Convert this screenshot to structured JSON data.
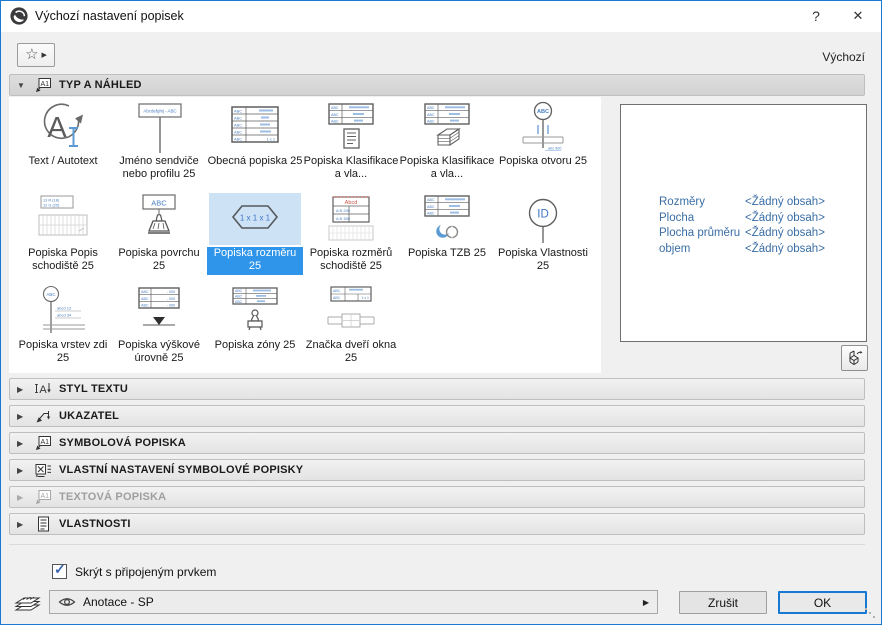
{
  "window": {
    "title": "Výchozí nastavení popisek",
    "help_glyph": "?",
    "close_glyph": "✕"
  },
  "toolbar": {
    "default_label": "Výchozí"
  },
  "sections": {
    "expanded_label": "TYP A NÁHLED",
    "collapsed": [
      {
        "label": "STYL TEXTU"
      },
      {
        "label": "UKAZATEL"
      },
      {
        "label": "SYMBOLOVÁ POPISKA"
      },
      {
        "label": "VLASTNÍ NASTAVENÍ SYMBOLOVÉ POPISKY"
      },
      {
        "label": "TEXTOVÁ POPISKA",
        "disabled": true
      },
      {
        "label": "VLASTNOSTI"
      }
    ]
  },
  "label_types": {
    "items": [
      {
        "label": "Text / Autotext"
      },
      {
        "label": "Jméno sendviče nebo profilu 25"
      },
      {
        "label": "Obecná popiska 25"
      },
      {
        "label": "Popiska Klasifikace a vla..."
      },
      {
        "label": "Popiska Klasifikace a vla..."
      },
      {
        "label": "Popiska otvoru 25"
      },
      {
        "label": "Popiska Popis schodiště 25"
      },
      {
        "label": "Popiska povrchu 25"
      },
      {
        "label": "Popiska rozměru 25",
        "selected": true
      },
      {
        "label": "Popiska rozměrů schodiště 25"
      },
      {
        "label": "Popiska TZB 25"
      },
      {
        "label": "Popiska Vlastnosti 25"
      },
      {
        "label": "Popiska vrstev zdi 25"
      },
      {
        "label": "Popiska výškové úrovně 25"
      },
      {
        "label": "Popiska zóny 25"
      },
      {
        "label": "Značka dveří okna 25"
      }
    ]
  },
  "icon_texts": {
    "autotext_a": "A",
    "sign": "Abcdefghij - ABC",
    "abc": "ABC",
    "hex": "1 x 1 x 1",
    "id": "ID",
    "stair_r": "13 R (18)",
    "stair_g": "12 G (25)",
    "dim_header": "Abcd",
    "dim_r1": "A B   200",
    "dim_r2": "A B   300",
    "layers_r1": "abcd   12",
    "layers_r2": "abcd   34",
    "abc900": "abc  900",
    "neg": "- 000",
    "one_by_one": "1 x 1"
  },
  "preview": {
    "rows": [
      {
        "name": "Rozměry",
        "value": "<Žádný obsah>"
      },
      {
        "name": "Plocha",
        "value": "<Žádný obsah>"
      },
      {
        "name": "Plocha průměru",
        "value": "<Žádný obsah>"
      },
      {
        "name": "objem",
        "value": "<Žádný obsah>"
      }
    ]
  },
  "footer": {
    "hide_checkbox_label": "Skrýt s připojeným prvkem",
    "hide_checked": true,
    "layer_value": "Anotace - SP",
    "cancel_label": "Zrušit",
    "ok_label": "OK"
  },
  "colors": {
    "accent": "#1779d2",
    "selection": "#2e95ea",
    "selection_light": "#cde3f5",
    "icon_blue": "#4a7fc1",
    "preview_text": "#3a6ea5"
  }
}
